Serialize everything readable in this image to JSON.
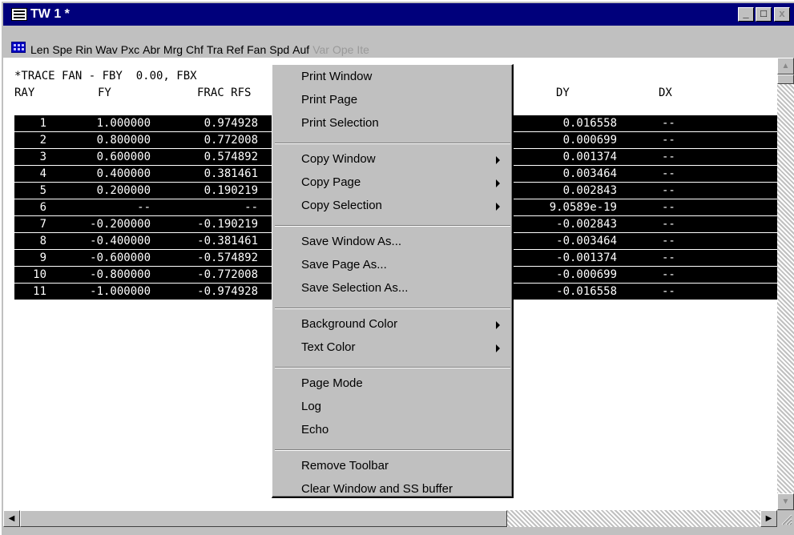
{
  "window": {
    "title": "TW 1 *",
    "buttons": {
      "minimize": "_",
      "maximize": "□",
      "close": "x"
    }
  },
  "toolbar": {
    "items": [
      {
        "label": "Len",
        "enabled": true
      },
      {
        "label": "Spe",
        "enabled": true
      },
      {
        "label": "Rin",
        "enabled": true
      },
      {
        "label": "Wav",
        "enabled": true
      },
      {
        "label": "Pxc",
        "enabled": true
      },
      {
        "label": "Abr",
        "enabled": true
      },
      {
        "label": "Mrg",
        "enabled": true
      },
      {
        "label": "Chf",
        "enabled": true
      },
      {
        "label": "Tra",
        "enabled": true
      },
      {
        "label": "Ref",
        "enabled": true
      },
      {
        "label": "Fan",
        "enabled": true
      },
      {
        "label": "Spd",
        "enabled": true
      },
      {
        "label": "Auf",
        "enabled": true
      },
      {
        "label": "Var",
        "enabled": false
      },
      {
        "label": "Ope",
        "enabled": false
      },
      {
        "label": "Ite",
        "enabled": false
      }
    ]
  },
  "report": {
    "heading": "*TRACE FAN - FBY  0.00, FBX",
    "columns": {
      "ray": "RAY",
      "fy": "FY",
      "frac": "FRAC RFS",
      "dy": "DY",
      "dx": "DX"
    },
    "rows": [
      {
        "ray": "1",
        "fy": "1.000000",
        "frac": "0.974928",
        "dy": "0.016558",
        "dx": "--"
      },
      {
        "ray": "2",
        "fy": "0.800000",
        "frac": "0.772008",
        "dy": "0.000699",
        "dx": "--"
      },
      {
        "ray": "3",
        "fy": "0.600000",
        "frac": "0.574892",
        "dy": "0.001374",
        "dx": "--"
      },
      {
        "ray": "4",
        "fy": "0.400000",
        "frac": "0.381461",
        "dy": "0.003464",
        "dx": "--"
      },
      {
        "ray": "5",
        "fy": "0.200000",
        "frac": "0.190219",
        "dy": "0.002843",
        "dx": "--"
      },
      {
        "ray": "6",
        "fy": "--",
        "frac": "--",
        "dy": "9.0589e-19",
        "dx": "--"
      },
      {
        "ray": "7",
        "fy": "-0.200000",
        "frac": "-0.190219",
        "dy": "-0.002843",
        "dx": "--"
      },
      {
        "ray": "8",
        "fy": "-0.400000",
        "frac": "-0.381461",
        "dy": "-0.003464",
        "dx": "--"
      },
      {
        "ray": "9",
        "fy": "-0.600000",
        "frac": "-0.574892",
        "dy": "-0.001374",
        "dx": "--"
      },
      {
        "ray": "10",
        "fy": "-0.800000",
        "frac": "-0.772008",
        "dy": "-0.000699",
        "dx": "--"
      },
      {
        "ray": "11",
        "fy": "-1.000000",
        "frac": "-0.974928",
        "dy": "-0.016558",
        "dx": "--"
      }
    ]
  },
  "context_menu": {
    "groups": [
      [
        {
          "label": "Print Window",
          "submenu": false
        },
        {
          "label": "Print Page",
          "submenu": false
        },
        {
          "label": "Print Selection",
          "submenu": false
        }
      ],
      [
        {
          "label": "Copy Window",
          "submenu": true
        },
        {
          "label": "Copy Page",
          "submenu": true
        },
        {
          "label": "Copy Selection",
          "submenu": true
        }
      ],
      [
        {
          "label": "Save Window As...",
          "submenu": false
        },
        {
          "label": "Save Page As...",
          "submenu": false
        },
        {
          "label": "Save Selection As...",
          "submenu": false
        }
      ],
      [
        {
          "label": "Background Color",
          "submenu": true
        },
        {
          "label": "Text Color",
          "submenu": true
        }
      ],
      [
        {
          "label": "Page Mode",
          "submenu": false
        },
        {
          "label": "Log",
          "submenu": false
        },
        {
          "label": "Echo",
          "submenu": false
        }
      ],
      [
        {
          "label": "Remove Toolbar",
          "submenu": false
        },
        {
          "label": "Clear Window and SS buffer",
          "submenu": false
        }
      ]
    ]
  },
  "colors": {
    "titlebar": "#00007b",
    "selection_bg": "#000000",
    "selection_fg": "#ffffff",
    "disabled_text": "#9a9a9a"
  }
}
